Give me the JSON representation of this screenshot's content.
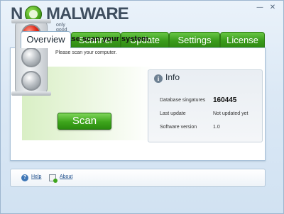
{
  "window": {
    "minimize_glyph": "—",
    "close_glyph": "✕"
  },
  "logo": {
    "n": "N",
    "main": "MALWARE",
    "tagline": "only good ware",
    "icon": "green-o-icon"
  },
  "tabs": [
    {
      "label": "Overview",
      "active": true
    },
    {
      "label": "Scanner",
      "active": false
    },
    {
      "label": "Update",
      "active": false
    },
    {
      "label": "Settings",
      "active": false
    },
    {
      "label": "License",
      "active": false
    }
  ],
  "scan": {
    "title": "Please scan your system.",
    "subtitle": "Please scan your computer.",
    "button_label": "Scan",
    "status_light": "red"
  },
  "info": {
    "title": "Info",
    "icon": "info-icon",
    "rows": [
      {
        "label": "Database singatures",
        "value": "160445"
      },
      {
        "label": "Last update",
        "value": "Not updated yet"
      },
      {
        "label": "Software version",
        "value": "1.0"
      }
    ]
  },
  "footer": {
    "help_label": "Help",
    "about_label": "About"
  },
  "colors": {
    "accent_green": "#3a9b1c",
    "status_red": "#e02b18",
    "link_blue": "#1f4f8c"
  }
}
